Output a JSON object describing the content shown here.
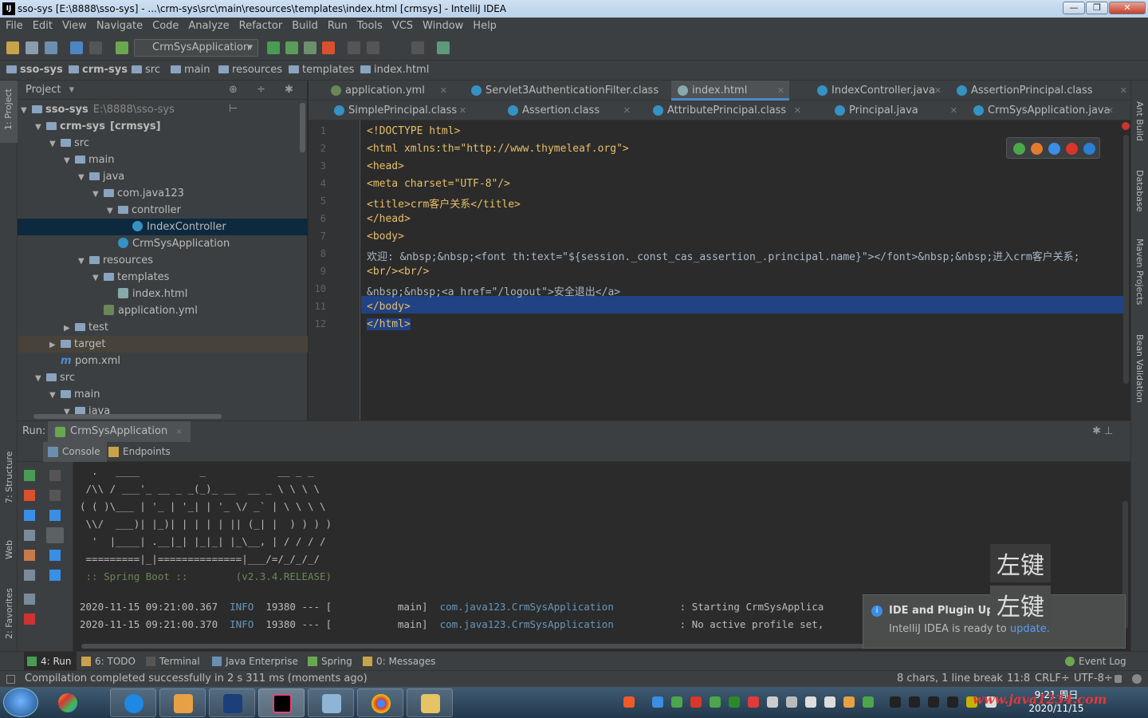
{
  "window": {
    "title": "sso-sys [E:\\8888\\sso-sys] - ...\\crm-sys\\src\\main\\resources\\templates\\index.html [crmsys] - IntelliJ IDEA",
    "min": "—",
    "max": "❐",
    "close": "✕"
  },
  "menu": [
    "File",
    "Edit",
    "View",
    "Navigate",
    "Code",
    "Analyze",
    "Refactor",
    "Build",
    "Run",
    "Tools",
    "VCS",
    "Window",
    "Help"
  ],
  "toolbar": {
    "run_config": "CrmSysApplication"
  },
  "breadcrumb": [
    "sso-sys",
    "crm-sys",
    "src",
    "main",
    "resources",
    "templates",
    "index.html"
  ],
  "left_strip": {
    "project": "1: Project",
    "structure": "7: Structure",
    "web": "Web",
    "favorites": "2: Favorites"
  },
  "right_strip": {
    "ant": "Ant Build",
    "database": "Database",
    "maven": "Maven Projects",
    "bean": "Bean Validation"
  },
  "project_panel": {
    "header": "Project",
    "tree": [
      {
        "label": "sso-sys",
        "extra": "E:\\8888\\sso-sys",
        "depth": 0,
        "kind": "module"
      },
      {
        "label": "crm-sys",
        "extra": "[crmsys]",
        "depth": 1,
        "kind": "module"
      },
      {
        "label": "src",
        "depth": 2,
        "kind": "folder"
      },
      {
        "label": "main",
        "depth": 3,
        "kind": "folder"
      },
      {
        "label": "java",
        "depth": 4,
        "kind": "folder"
      },
      {
        "label": "com.java123",
        "depth": 5,
        "kind": "folder"
      },
      {
        "label": "controller",
        "depth": 6,
        "kind": "folder"
      },
      {
        "label": "IndexController",
        "depth": 7,
        "kind": "class",
        "selected": true
      },
      {
        "label": "CrmSysApplication",
        "depth": 6,
        "kind": "class"
      },
      {
        "label": "resources",
        "depth": 4,
        "kind": "folder"
      },
      {
        "label": "templates",
        "depth": 5,
        "kind": "folder"
      },
      {
        "label": "index.html",
        "depth": 6,
        "kind": "html"
      },
      {
        "label": "application.yml",
        "depth": 5,
        "kind": "yml"
      },
      {
        "label": "test",
        "depth": 3,
        "kind": "folder",
        "collapsed": true
      },
      {
        "label": "target",
        "depth": 2,
        "kind": "folder",
        "collapsed": true,
        "highlight": true
      },
      {
        "label": "pom.xml",
        "depth": 2,
        "kind": "maven"
      },
      {
        "label": "src",
        "depth": 1,
        "kind": "folder"
      },
      {
        "label": "main",
        "depth": 2,
        "kind": "folder"
      },
      {
        "label": "java",
        "depth": 3,
        "kind": "folder"
      }
    ]
  },
  "editor": {
    "tabs_row1": [
      {
        "label": "application.yml"
      },
      {
        "label": "Servlet3AuthenticationFilter.class"
      },
      {
        "label": "index.html",
        "active": true
      },
      {
        "label": "IndexController.java"
      },
      {
        "label": "AssertionPrincipal.class"
      }
    ],
    "tabs_row2": [
      {
        "label": "SimplePrincipal.class"
      },
      {
        "label": "Assertion.class"
      },
      {
        "label": "AttributePrincipal.class"
      },
      {
        "label": "Principal.java"
      },
      {
        "label": "CrmSysApplication.java"
      }
    ],
    "line_numbers": [
      "1",
      "2",
      "3",
      "4",
      "5",
      "6",
      "7",
      "8",
      "9",
      "10",
      "11",
      "12"
    ],
    "lines": [
      "<!DOCTYPE html>",
      "<html xmlns:th=\"http://www.thymeleaf.org\">",
      "<head>",
      "<meta charset=\"UTF-8\"/>",
      "<title>crm客户关系</title>",
      "</head>",
      "<body>",
      "欢迎: &nbsp;&nbsp;<font th:text=\"${session._const_cas_assertion_.principal.name}\"></font>&nbsp;&nbsp;进入crm客户关系;",
      "<br/><br/>",
      "&nbsp;&nbsp;<a href=\"/logout\">安全退出</a>",
      "</body>",
      "</html>"
    ]
  },
  "run_panel": {
    "label": "Run:",
    "config": "CrmSysApplication",
    "tabs": [
      "Console",
      "Endpoints"
    ],
    "banner": [
      "  .   ____          _            __ _ _",
      " /\\\\ / ___'_ __ _ _(_)_ __  __ _ \\ \\ \\ \\",
      "( ( )\\___ | '_ | '_| | '_ \\/ _` | \\ \\ \\ \\",
      " \\\\/  ___)| |_)| | | | | || (_| |  ) ) ) )",
      "  '  |____| .__|_| |_|_| |_\\__, | / / / /",
      " =========|_|==============|___/=/_/_/_/"
    ],
    "spring_line": " :: Spring Boot ::        (v2.3.4.RELEASE)",
    "log": [
      {
        "ts": "2020-11-15 09:21:00.367",
        "level": "INFO",
        "pid": "19380 --- [",
        "thread": "           main]",
        "logger": "com.java123.CrmSysApplication",
        "msg": ": Starting CrmSysApplica"
      },
      {
        "ts": "2020-11-15 09:21:00.370",
        "level": "INFO",
        "pid": "19380 --- [",
        "thread": "           main]",
        "logger": "com.java123.CrmSysApplication",
        "msg": ": No active profile set,"
      }
    ]
  },
  "notification": {
    "title": "IDE and Plugin Upda",
    "body": "IntelliJ IDEA is ready to ",
    "link": "update."
  },
  "overlay": {
    "key1": "左键",
    "key2": "左键"
  },
  "bottom_tabs": [
    "4: Run",
    "6: TODO",
    "Terminal",
    "Java Enterprise",
    "Spring",
    "0: Messages"
  ],
  "event_log": "Event Log",
  "status": {
    "message": "Compilation completed successfully in 2 s 311 ms (moments ago)",
    "selection": "8 chars, 1 line break",
    "position": "11:8",
    "line_sep": "CRLF÷",
    "encoding": "UTF-8÷"
  },
  "ime": {
    "lang": "中"
  },
  "taskbar": {
    "time": "9:21 周日",
    "date": "2020/11/15",
    "watermark": "www.java1234.com"
  }
}
